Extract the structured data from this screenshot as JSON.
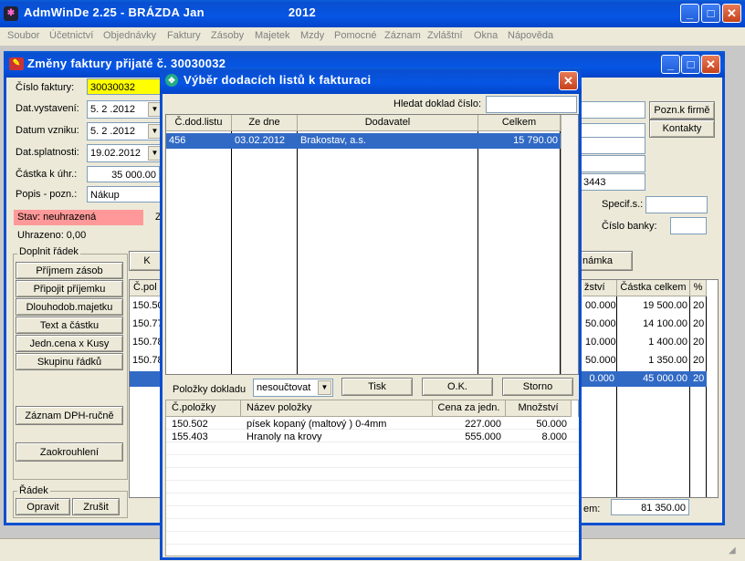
{
  "app": {
    "title_name": "AdmWinDe 2.25 - BRÁZDA Jan",
    "title_year": "2012"
  },
  "menu": [
    "Soubor",
    "Účetnictví",
    "Objednávky",
    "Faktury",
    "Zásoby",
    "Majetek",
    "Mzdy",
    "Pomocné",
    "Záznam",
    "Zvláštní",
    "Okna",
    "Nápověda"
  ],
  "invoice": {
    "title": "Změny faktury přijaté č. 30030032",
    "cislo_label": "Číslo faktury:",
    "cislo_value": "30030032",
    "vystaveni_label": "Dat.vystavení:",
    "vystaveni_value": "5. 2 .2012",
    "vzniku_label": "Datum vzniku:",
    "vzniku_value": "5. 2 .2012",
    "splatnosti_label": "Dat.splatnosti:",
    "splatnosti_value": "19.02.2012",
    "castka_label": "Částka k úhr.:",
    "castka_value": "35 000.00",
    "popis_label": "Popis - pozn.:",
    "popis_value": "Nákup",
    "stav": "Stav: neuhrazená",
    "stav_z": "Z",
    "uhrazeno": "Uhrazeno: 0,00",
    "right_code": "3443",
    "specif_label": "Specif.s.:",
    "banky_label": "Číslo banky:",
    "pozn_firme": "Pozn.k firmě",
    "kontakty": "Kontakty",
    "doplnit_label": "Doplnit řádek",
    "doplnit_buttons": [
      "Příjmem zásob",
      "Připojit příjemku",
      "Dlouhodob.majetku",
      "Text a částku",
      "Jedn.cena x Kusy",
      "Skupinu řádků"
    ],
    "zaznam_dph": "Záznam DPH-ručně",
    "zaokrouhleni": "Zaokrouhlení",
    "radek_label": "Řádek",
    "opravit": "Opravit",
    "zrusit": "Zrušit",
    "k_button": "K",
    "poznamka_button": "námka",
    "grid_headers": [
      "Č.pol",
      "žství",
      "Částka celkem",
      "%"
    ],
    "grid_rows": [
      {
        "c": "150.50",
        "m": "00.000",
        "s": "19 500.00",
        "p": "20"
      },
      {
        "c": "150.77",
        "m": "50.000",
        "s": "14 100.00",
        "p": "20"
      },
      {
        "c": "150.78",
        "m": "10.000",
        "s": "1 400.00",
        "p": "20"
      },
      {
        "c": "150.78",
        "m": "50.000",
        "s": "1 350.00",
        "p": "20"
      },
      {
        "c": "",
        "m": "0.000",
        "s": "45 000.00",
        "p": "20"
      }
    ],
    "celkem_label": "em:",
    "celkem_value": "81 350.00"
  },
  "dialog": {
    "title": "Výběr dodacích listů k fakturaci",
    "hledat_label": "Hledat doklad číslo:",
    "hledat_value": "",
    "headers": [
      "Č.dod.listu",
      "Ze dne",
      "Dodavatel",
      "Celkem"
    ],
    "rows": [
      {
        "cislo": "456",
        "datum": "03.02.2012",
        "dodavatel": "Brakostav, a.s.",
        "celkem": "15 790.00"
      }
    ],
    "polozky_label": "Položky dokladu",
    "polozky_select": "nesoučtovat",
    "tisk": "Tisk",
    "ok": "O.K.",
    "storno": "Storno",
    "item_headers": [
      "Č.položky",
      "Název položky",
      "Cena za jedn.",
      "Množství"
    ],
    "items": [
      {
        "cislo": "150.502",
        "nazev": "písek kopaný (maltový ) 0-4mm",
        "cena": "227.000",
        "mnozstvi": "50.000"
      },
      {
        "cislo": "155.403",
        "nazev": "Hranoly na krovy",
        "cena": "555.000",
        "mnozstvi": "8.000"
      }
    ]
  }
}
